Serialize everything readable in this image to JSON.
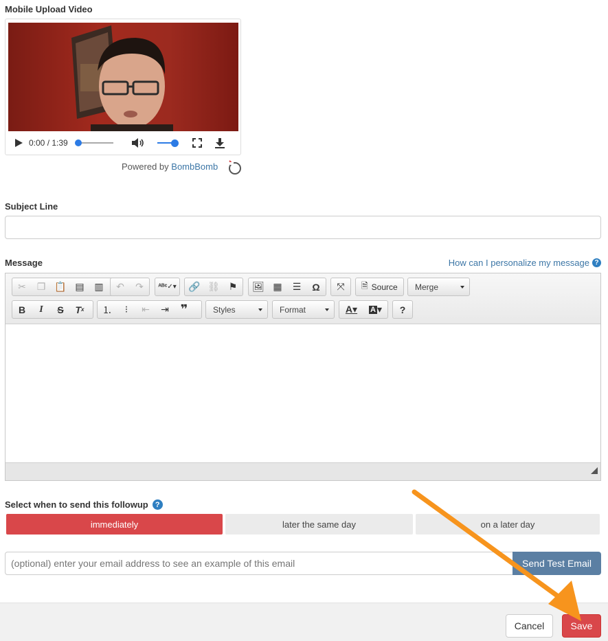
{
  "video_section": {
    "title": "Mobile Upload Video",
    "time": "0:00 / 1:39",
    "powered_prefix": "Powered by",
    "powered_brand": "BombBomb"
  },
  "subject": {
    "label": "Subject Line",
    "value": ""
  },
  "message": {
    "label": "Message",
    "help_link": "How can I personalize my message",
    "toolbar": {
      "source_label": "Source",
      "merge_label": "Merge",
      "styles_label": "Styles",
      "format_label": "Format"
    }
  },
  "send_timing": {
    "label": "Select when to send this followup",
    "options": [
      "immediately",
      "later the same day",
      "on a later day"
    ],
    "selected": "immediately"
  },
  "test_email": {
    "placeholder": "(optional) enter your email address to see an example of this email",
    "button_label": "Send Test Email"
  },
  "footer": {
    "cancel_label": "Cancel",
    "save_label": "Save"
  },
  "colors": {
    "accent_red": "#d9474a",
    "link_blue": "#3c76a6",
    "test_button": "#5b7fa3",
    "arrow_orange": "#f7941d"
  }
}
